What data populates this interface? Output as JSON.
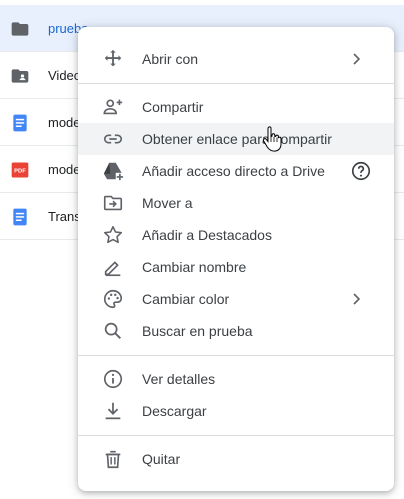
{
  "files": [
    {
      "name": "prueba",
      "icon": "folder-icon",
      "selected": true
    },
    {
      "name": "Video",
      "icon": "shared-folder-icon"
    },
    {
      "name": "mode",
      "icon": "google-doc-icon"
    },
    {
      "name": "mode",
      "icon": "pdf-icon"
    },
    {
      "name": "Trans",
      "icon": "google-doc-icon"
    }
  ],
  "menu": {
    "open_with": "Abrir con",
    "share": "Compartir",
    "get_link": "Obtener enlace para compartir",
    "add_shortcut": "Añadir acceso directo a Drive",
    "move_to": "Mover a",
    "add_starred": "Añadir a Destacados",
    "rename": "Cambiar nombre",
    "change_color": "Cambiar color",
    "search_in": "Buscar en prueba",
    "view_details": "Ver detalles",
    "download": "Descargar",
    "remove": "Quitar"
  },
  "pdf_badge": "PDF",
  "colors": {
    "selected_row": "#e8f0fe",
    "doc_blue": "#4285f4",
    "pdf_red": "#ea4335",
    "icon_gray": "#5f6368"
  }
}
